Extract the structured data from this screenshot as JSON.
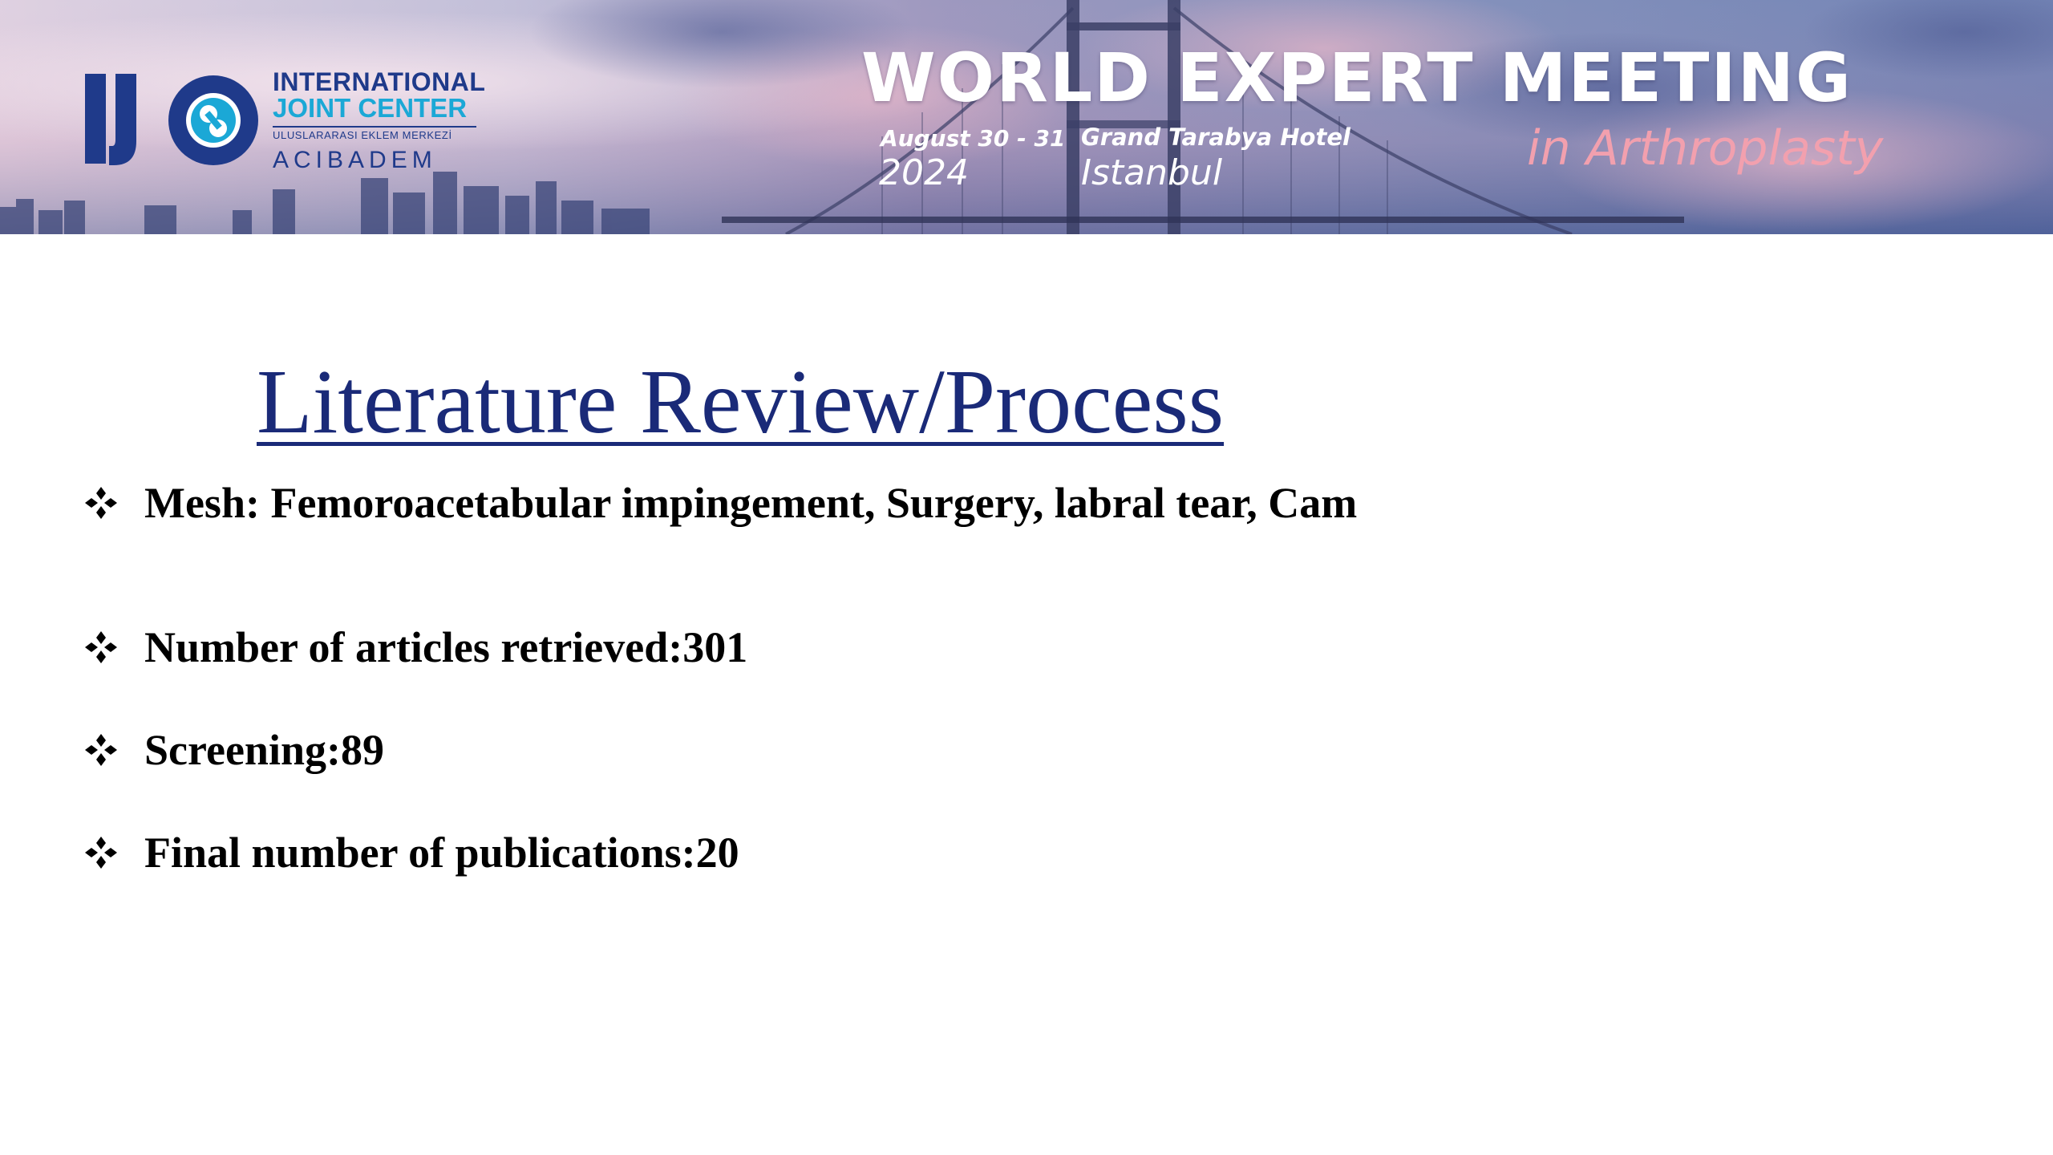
{
  "banner": {
    "logo": {
      "mark_text": "IJC",
      "line1": "INTERNATIONAL",
      "line2": "JOINT CENTER",
      "line3": "ULUSLARARASI EKLEM MERKEZİ",
      "line4": "ACIBADEM"
    },
    "event": {
      "title": "WORLD EXPERT MEETING",
      "dates": "August 30 - 31",
      "year": "2024",
      "venue": "Grand Tarabya Hotel",
      "city": "Istanbul",
      "subtitle": "in Arthroplasty"
    },
    "colors": {
      "logo_navy": "#1f3a8a",
      "logo_cyan": "#1ba8d6",
      "subtitle_pink": "#f2a0ae"
    },
    "icons": [
      "joint-logo-icon",
      "bridge-skyline-illustration"
    ]
  },
  "slide": {
    "title": "Literature Review/Process",
    "title_color": "#1a2a78",
    "bullet_icon": "four-diamond-bullet-icon",
    "bullets": [
      "Mesh: Femoroacetabular impingement, Surgery, labral tear, Cam",
      "Number of articles retrieved:301",
      "Screening:89",
      "Final number of publications:20"
    ]
  }
}
